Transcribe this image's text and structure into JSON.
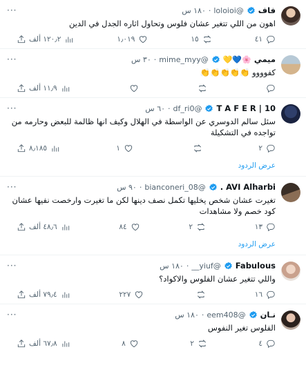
{
  "colors": {
    "accent": "#1d9bf0",
    "muted": "#536471",
    "text": "#0f1419",
    "divider": "#eff3f4"
  },
  "icons": {
    "reply": "reply-icon",
    "retweet": "retweet-icon",
    "like": "heart-icon",
    "views": "views-icon",
    "share": "share-icon",
    "verified": "verified-badge-icon",
    "more": "more-icon"
  },
  "show_replies_label": "عرض الردود",
  "tweets": [
    {
      "name": "فاف",
      "handle": "@loloioi",
      "dot": "·",
      "time": "١٨٠ س",
      "text": "اهون من اللي تتغير عشان فلوس وتحاول اثاره الجدل في الدين",
      "replies": "٤١",
      "retweets": "١٥",
      "likes": "١٫٠١٩",
      "views": "١٢٠٫٢ ألف"
    },
    {
      "name": "ميمي",
      "name_emojis": "🌸💙💛",
      "handle": "@mime_myy",
      "dot": "·",
      "time": "٣٠ س",
      "text": "كفوووو 👏👏👏👏👏",
      "replies": "",
      "retweets": "",
      "likes": "",
      "views": "١١٫٩ ألف"
    },
    {
      "name": "T A F E R | 10",
      "handle": "@df_ri0",
      "dot": "·",
      "time": "٦٠ س",
      "text": "سئل سالم الدوسري عن الواسطة في الهلال وكيف انها ظالمة للبعض وحارمه من تواجده في التشكيلة",
      "replies": "٢",
      "retweets": "",
      "likes": "١",
      "views": "٨٫١٨٥",
      "show_replies": true
    },
    {
      "name": "AVI Alharbi .",
      "handle": "@bianconeri_08",
      "dot": "·",
      "time": "٩٠ س",
      "text": "تغيرت عشان شخص يخليها تكمل نصف دينها لكن ما تغيرت وارخصت نفيها عشان كود خصم ولا مشاهدات",
      "replies": "١٣",
      "retweets": "٢",
      "likes": "٨٤",
      "views": "٤٨٫٦ ألف",
      "show_replies": true
    },
    {
      "name": "Fabulous",
      "handle": "@yiuf__",
      "dot": "·",
      "time": "١٨٠ س",
      "text": "واللي تتغير عشان الفلوس والاكواد؟",
      "replies": "١٦",
      "retweets": "",
      "likes": "٢٢٧",
      "views": "٧٩٫٤ ألف"
    },
    {
      "name": "نـان",
      "handle": "@eem408",
      "dot": "·",
      "time": "١٨٠ س",
      "text": "الفلوس تغير النفوس",
      "replies": "٤",
      "retweets": "٢",
      "likes": "٨",
      "views": "٦٧٫٨ ألف"
    }
  ]
}
